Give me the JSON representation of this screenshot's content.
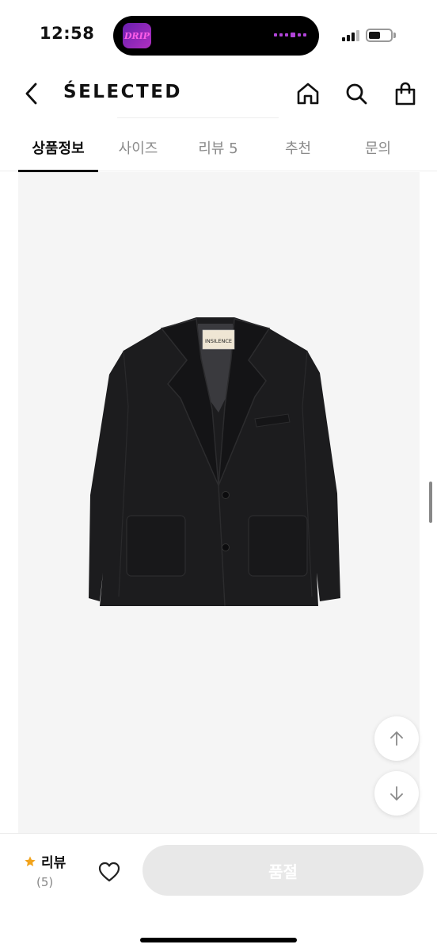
{
  "status_bar": {
    "time": "12:58",
    "island_app_label": "DRIP",
    "battery_level": 0.55
  },
  "header": {
    "brand": "ŚELECTED",
    "icons": [
      "back-icon",
      "home-icon",
      "search-icon",
      "shopping-bag-icon"
    ]
  },
  "tabs": [
    {
      "label": "상품정보",
      "active": true
    },
    {
      "label": "사이즈",
      "active": false
    },
    {
      "label": "리뷰 5",
      "active": false
    },
    {
      "label": "추천",
      "active": false
    },
    {
      "label": "문의",
      "active": false
    }
  ],
  "product": {
    "image_label": "INSILENCE",
    "image_bg": "#f5f5f5",
    "coat_color": "#1c1c1e"
  },
  "scroll_buttons": [
    "arrow-up-icon",
    "arrow-down-icon"
  ],
  "bottom_bar": {
    "review_label": "리뷰",
    "review_count": "(5)",
    "star_color": "#f2a31b",
    "cta_label": "품절"
  }
}
